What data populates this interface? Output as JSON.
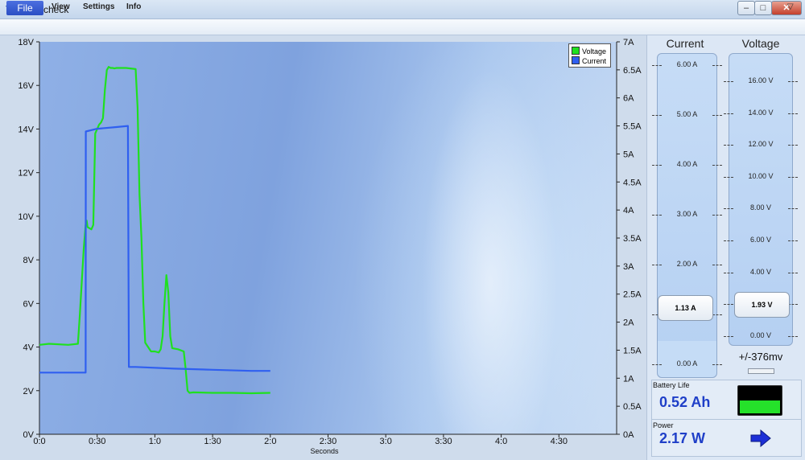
{
  "window": {
    "title": "PWRcheck",
    "controls": {
      "minimize": "–",
      "maximize": "□",
      "close": "✕"
    }
  },
  "menu": {
    "items": [
      "File",
      "View",
      "Settings",
      "Info"
    ],
    "overflow_icon": "chevron-down-icon"
  },
  "chart_data": {
    "type": "line",
    "xlabel": "Seconds",
    "x_ticks": [
      "0:0",
      "0:30",
      "1:0",
      "1:30",
      "2:0",
      "2:30",
      "3:0",
      "3:30",
      "4:0",
      "4:30"
    ],
    "xlim": [
      0,
      300
    ],
    "y_left_ticks": [
      "0V",
      "2V",
      "4V",
      "6V",
      "8V",
      "10V",
      "12V",
      "14V",
      "16V",
      "18V"
    ],
    "ylim_left": [
      0,
      18
    ],
    "y_right_ticks": [
      "0A",
      "0.5A",
      "1A",
      "1.5A",
      "2A",
      "2.5A",
      "3A",
      "3.5A",
      "4A",
      "4.5A",
      "5A",
      "5.5A",
      "6A",
      "6.5A",
      "7A"
    ],
    "ylim_right": [
      0,
      7
    ],
    "legend_position": "top-right",
    "grid": false,
    "series": [
      {
        "name": "Voltage",
        "axis": "left",
        "color": "#1fe01f",
        "x": [
          0,
          5,
          15,
          20,
          21,
          22,
          23,
          24,
          24.5,
          25,
          27,
          28,
          29,
          31,
          32,
          33,
          34,
          35,
          36,
          37,
          38,
          39,
          40,
          45,
          50,
          51,
          52,
          53,
          54,
          55,
          58,
          60,
          62,
          63,
          64,
          65,
          66,
          67,
          68,
          69,
          72,
          75,
          76,
          77,
          78,
          80,
          90,
          100,
          110,
          120
        ],
        "values": [
          4.1,
          4.15,
          4.1,
          4.15,
          5.5,
          7.0,
          8.5,
          9.6,
          9.8,
          9.5,
          9.4,
          9.6,
          13.8,
          14.2,
          14.3,
          14.5,
          15.8,
          16.7,
          16.85,
          16.8,
          16.8,
          16.78,
          16.8,
          16.8,
          16.75,
          15.0,
          11.0,
          9.0,
          6.0,
          4.2,
          3.8,
          3.8,
          3.75,
          3.9,
          4.5,
          6.0,
          7.3,
          6.5,
          4.5,
          3.95,
          3.9,
          3.8,
          3.0,
          2.0,
          1.9,
          1.92,
          1.9,
          1.9,
          1.88,
          1.9
        ]
      },
      {
        "name": "Current",
        "axis": "right",
        "color": "#2f5ff0",
        "x": [
          0,
          15,
          24,
          24.1,
          30,
          40,
          46,
          46.5,
          50,
          70,
          90,
          110,
          120
        ],
        "values": [
          1.1,
          1.1,
          1.1,
          5.4,
          5.45,
          5.48,
          5.5,
          1.2,
          1.2,
          1.17,
          1.15,
          1.13,
          1.13
        ]
      }
    ]
  },
  "panel": {
    "current": {
      "title": "Current",
      "ticks": [
        "6.00 A",
        "5.00 A",
        "4.00 A",
        "3.00 A",
        "2.00 A",
        "1.00 A",
        "0.00 A"
      ],
      "value": "1.13 A",
      "value_fraction": 0.188
    },
    "voltage": {
      "title": "Voltage",
      "ticks": [
        "16.00 V",
        "14.00 V",
        "12.00 V",
        "10.00 V",
        "8.00 V",
        "6.00 V",
        "4.00 V",
        "2.00 V",
        "0.00 V"
      ],
      "value": "1.93 V",
      "tolerance": "+/-376mv"
    },
    "battery": {
      "label": "Battery Life",
      "value": "0.52 Ah",
      "level_fraction": 0.45,
      "level_color": "#25e12a"
    },
    "power": {
      "label": "Power",
      "value": "2.17 W",
      "arrow_color": "#1c2fd6"
    }
  }
}
